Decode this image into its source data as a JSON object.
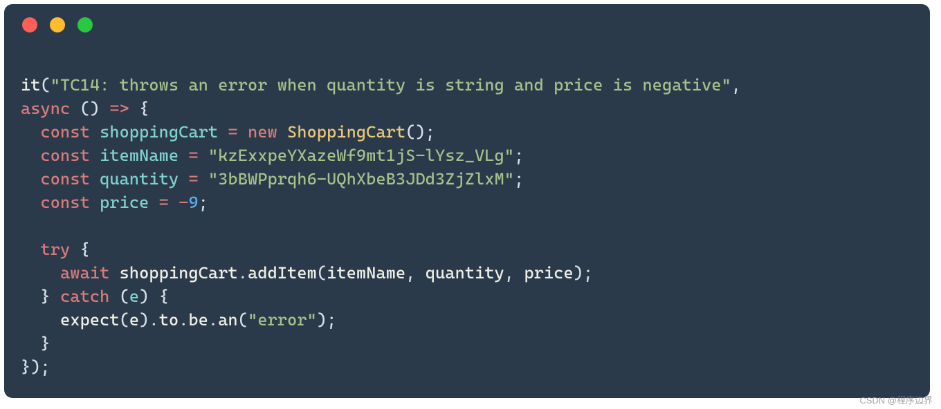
{
  "watermark": "CSDN @程序边界",
  "code": {
    "fn_it": "it",
    "test_desc": "\"TC14: throws an error when quantity is string and price is negative\"",
    "kw_async": "async",
    "arrow_open": "() ",
    "arrow_sym": "=>",
    "brace_open": " {",
    "kw_const": "const",
    "v_cart": "shoppingCart",
    "eq": " = ",
    "kw_new": "new",
    "cls_cart": "ShoppingCart",
    "paren_empty": "();",
    "v_itemName": "itemName",
    "s_itemName": "\"kzExxpeYXazeWf9mt1jS-lYsz_VLg\"",
    "v_quantity": "quantity",
    "s_quantity": "\"3bBWPprqh6-UQhXbeB3JDd3ZjZlxM\"",
    "v_price": "price",
    "n_price_neg": "-",
    "n_price_val": "9",
    "kw_try": "try",
    "kw_await": "await",
    "m_addItem": "addItem",
    "kw_catch": "catch",
    "v_e": "e",
    "fn_expect": "expect",
    "m_to": "to",
    "m_be": "be",
    "m_an": "an",
    "s_error": "\"error\"",
    "semi": ";",
    "close_brace": "}",
    "close_all": "});",
    "comma": ","
  }
}
